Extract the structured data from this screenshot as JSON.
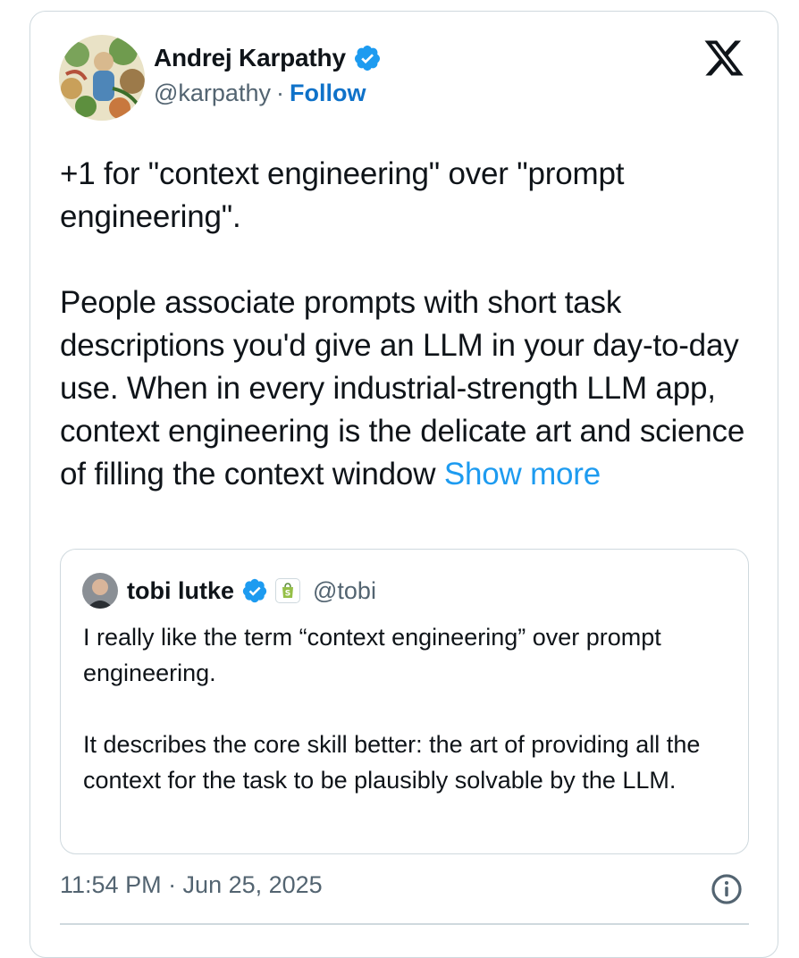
{
  "author": {
    "name": "Andrej Karpathy",
    "handle": "@karpathy",
    "separator": "·",
    "follow_label": "Follow"
  },
  "brand_icon": "x-logo-icon",
  "tweet": {
    "paragraph1": "+1 for \"context engineering\" over \"prompt engineering\".",
    "paragraph2": "People associate prompts with short task descriptions you'd give an LLM in your day-to-day use. When in every industrial-strength LLM app, context engineering is the delicate art and science of filling the context window",
    "show_more": "Show more"
  },
  "quote": {
    "name": "tobi lutke",
    "handle": "@tobi",
    "badge_icon": "shopify-icon",
    "paragraph1": "I really like the term “context engineering” over prompt engineering.",
    "paragraph2": "It describes the core skill better: the art of providing all the context for the task to be plausibly solvable by the LLM."
  },
  "footer": {
    "timestamp": "11:54 PM · Jun 25, 2025",
    "info_icon": "info-icon"
  },
  "colors": {
    "link": "#1d9bf0",
    "follow": "#0f72c9",
    "verified": "#1d9bf0",
    "muted": "#536471",
    "border": "#cfd9de"
  }
}
